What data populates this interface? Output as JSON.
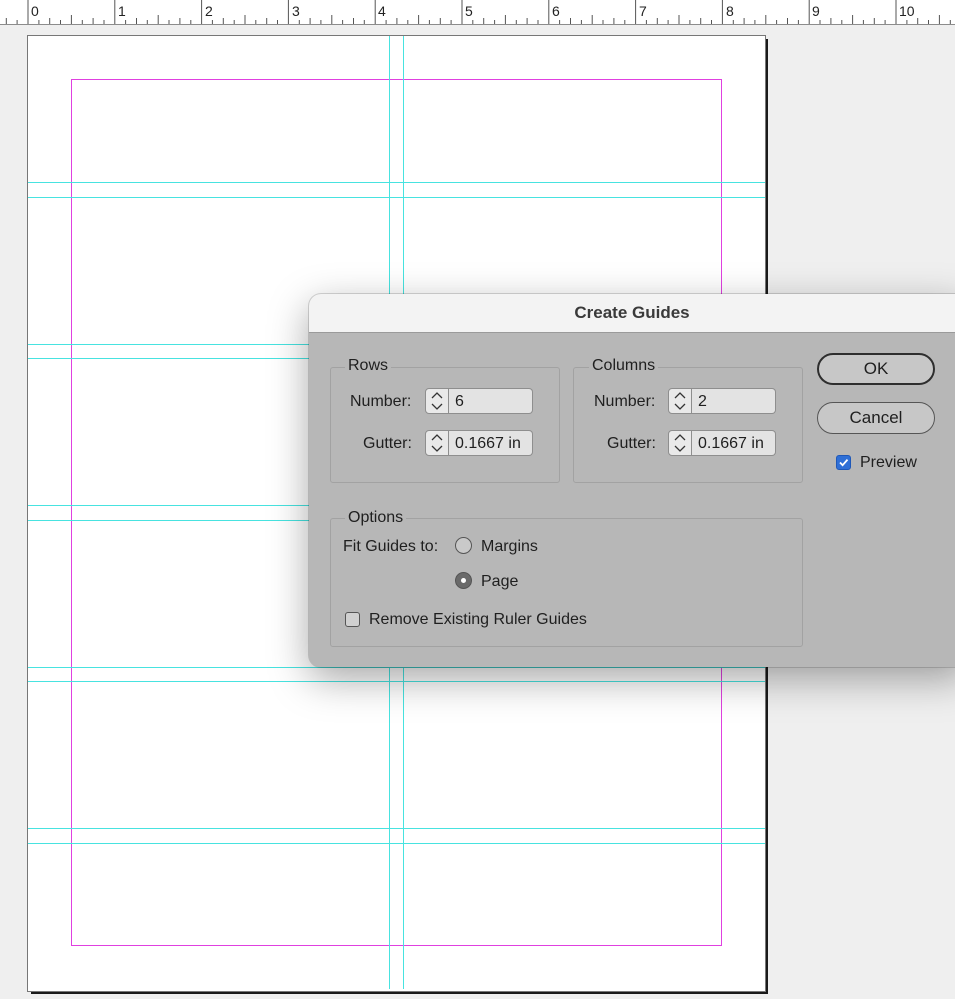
{
  "ruler": {
    "numbers": [
      "0",
      "1",
      "2",
      "3",
      "4",
      "5",
      "6",
      "7",
      "8",
      "9",
      "10"
    ]
  },
  "dialog": {
    "title": "Create Guides",
    "rows": {
      "label": "Rows",
      "number_label": "Number:",
      "number_value": "6",
      "gutter_label": "Gutter:",
      "gutter_value": "0.1667 in"
    },
    "columns": {
      "label": "Columns",
      "number_label": "Number:",
      "number_value": "2",
      "gutter_label": "Gutter:",
      "gutter_value": "0.1667 in"
    },
    "options": {
      "label": "Options",
      "fit_label": "Fit Guides to:",
      "margins_label": "Margins",
      "page_label": "Page",
      "fit_selected": "Page",
      "remove_label": "Remove Existing Ruler Guides",
      "remove_checked": false
    },
    "ok_label": "OK",
    "cancel_label": "Cancel",
    "preview_label": "Preview",
    "preview_checked": true
  },
  "colors": {
    "guide": "#47e3e0",
    "margin": "#e040e0",
    "checkbox_accent": "#2f6fd6"
  }
}
